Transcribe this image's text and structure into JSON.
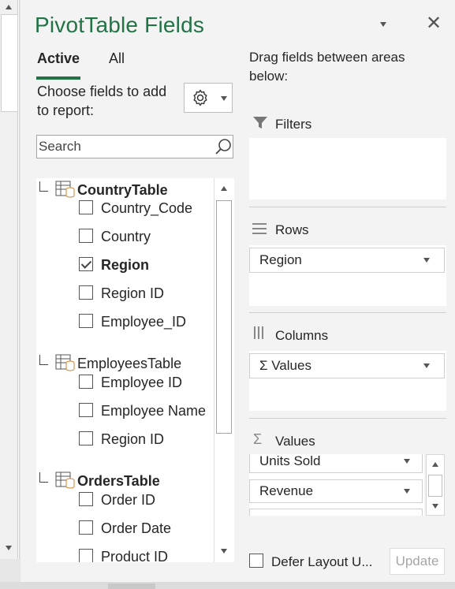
{
  "pane": {
    "title": "PivotTable Fields",
    "tabs": [
      {
        "label": "Active"
      },
      {
        "label": "All"
      }
    ],
    "choose_label": "Choose fields to add to report:",
    "search": {
      "placeholder": "Search",
      "value": ""
    }
  },
  "field_list": {
    "tables": [
      {
        "name": "CountryTable",
        "bold": true,
        "fields": [
          {
            "label": "Country_Code",
            "checked": false
          },
          {
            "label": "Country",
            "checked": false
          },
          {
            "label": "Region",
            "checked": true
          },
          {
            "label": "Region ID",
            "checked": false
          },
          {
            "label": "Employee_ID",
            "checked": false
          }
        ]
      },
      {
        "name": "EmployeesTable",
        "bold": false,
        "fields": [
          {
            "label": "Employee ID",
            "checked": false
          },
          {
            "label": "Employee Name",
            "checked": false
          },
          {
            "label": "Region ID",
            "checked": false
          }
        ]
      },
      {
        "name": "OrdersTable",
        "bold": true,
        "fields": [
          {
            "label": "Order ID",
            "checked": false
          },
          {
            "label": "Order Date",
            "checked": false
          },
          {
            "label": "Product ID",
            "checked": false
          }
        ]
      }
    ]
  },
  "areas": {
    "instructions": "Drag fields between areas below:",
    "filters": {
      "label": "Filters"
    },
    "rows": {
      "label": "Rows",
      "items": [
        "Region"
      ]
    },
    "columns": {
      "label": "Columns",
      "items": [
        "Σ Values"
      ]
    },
    "values": {
      "label": "Values",
      "items": [
        "Units Sold",
        "Revenue"
      ]
    }
  },
  "footer": {
    "defer_label": "Defer Layout U...",
    "update_label": "Update"
  },
  "colors": {
    "accent": "#217346",
    "pane_bg": "#f3f3f3"
  },
  "icons": [
    "settings-gear-icon",
    "search-icon",
    "table-icon",
    "filter-icon",
    "rows-icon",
    "columns-icon",
    "sigma-icon",
    "close-icon",
    "dropdown-caret-icon"
  ]
}
